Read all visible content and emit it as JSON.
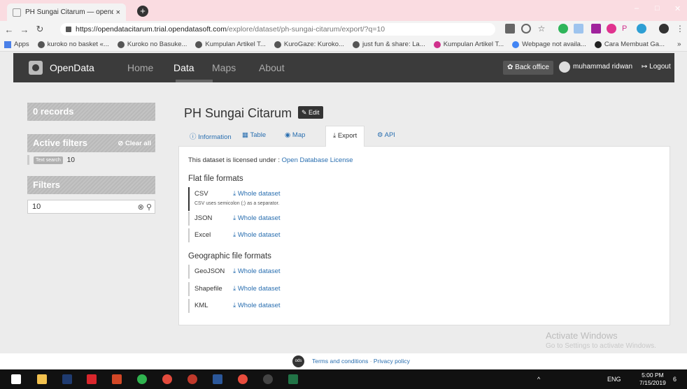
{
  "browser": {
    "tab_title": "PH Sungai Citarum — opendatac",
    "tab_close": "×",
    "new_tab": "+",
    "url_host": "https://opendatacitarum.trial.opendatasoft.com",
    "url_path": "/explore/dataset/ph-sungai-citarum/export/?q=10",
    "window_minimize": "–",
    "window_maximize": "□",
    "window_close": "✕",
    "bookmarks": [
      "Apps",
      "kuroko no basket «...",
      "Kuroko no Basuke...",
      "Kumpulan Artikel T...",
      "KuroGaze: Kuroko...",
      "just fun & share: La...",
      "Kumpulan Artikel T...",
      "Webpage not availa...",
      "Cara Membuat Ga..."
    ],
    "bookmarks_overflow": "»"
  },
  "header": {
    "brand": "OpenData",
    "nav": [
      "Home",
      "Data",
      "Maps",
      "About"
    ],
    "active_nav": "Data",
    "back_office": "✿ Back office",
    "user": "muhammad ridwan",
    "logout": "↦ Logout"
  },
  "sidebar": {
    "records": "0 records",
    "active_filters": "Active filters",
    "clear_all": "⊘ Clear all",
    "filter_chip": "Text search",
    "filter_value": "10",
    "filters": "Filters",
    "search_value": "10"
  },
  "dataset": {
    "title": "PH Sungai Citarum",
    "edit": "✎ Edit",
    "tabs": [
      "ⓘ Information",
      "▦ Table",
      "◉ Map",
      "⤓ Export",
      "⚙ API"
    ],
    "active_tab": "⤓ Export",
    "license_prefix": "This dataset is licensed under : ",
    "license_link": "Open Database License",
    "flat_heading": "Flat file formats",
    "geo_heading": "Geographic file formats",
    "flat_formats": [
      {
        "name": "CSV",
        "link": "⤓ Whole dataset",
        "note": "CSV uses semicolon (;) as a separator."
      },
      {
        "name": "JSON",
        "link": "⤓ Whole dataset"
      },
      {
        "name": "Excel",
        "link": "⤓ Whole dataset"
      }
    ],
    "geo_formats": [
      {
        "name": "GeoJSON",
        "link": "⤓ Whole dataset"
      },
      {
        "name": "Shapefile",
        "link": "⤓ Whole dataset"
      },
      {
        "name": "KML",
        "link": "⤓ Whole dataset"
      }
    ]
  },
  "footer": {
    "badge": "ods",
    "terms": "Terms and conditions",
    "separator": "·",
    "privacy": "Privacy policy"
  },
  "watermark": {
    "line1": "Activate Windows",
    "line2": "Go to Settings to activate Windows."
  },
  "taskbar": {
    "lang": "ENG",
    "time": "5:00 PM",
    "date": "7/15/2019",
    "notif_count": "6"
  },
  "colors": {
    "link": "#2a6fb0",
    "header_bg": "#3b3b3b",
    "titlebar_pink": "#fadce1"
  }
}
